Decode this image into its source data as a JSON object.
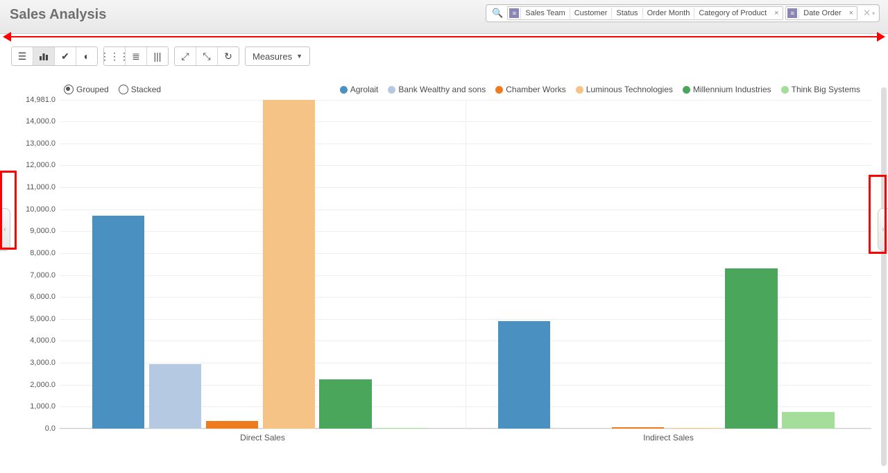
{
  "header": {
    "title": "Sales Analysis",
    "facets": [
      {
        "icon": "≡",
        "segments": [
          "Sales Team",
          "Customer",
          "Status",
          "Order Month",
          "Category of Product"
        ],
        "closable": true
      },
      {
        "icon": "≡",
        "segments": [
          "Date Order"
        ],
        "closable": true
      }
    ]
  },
  "toolbar": {
    "view_buttons": [
      {
        "name": "view-list-button",
        "glyph": "☰",
        "active": false
      },
      {
        "name": "view-chart-button",
        "glyph": "⫿",
        "active": true,
        "is_chart_icon": true
      },
      {
        "name": "view-check-button",
        "glyph": "✔",
        "active": false
      },
      {
        "name": "view-contrast-button",
        "glyph": "◐",
        "active": false
      }
    ],
    "layout_buttons": [
      {
        "name": "layout-grid-button",
        "glyph": "⋮⋮⋮",
        "active": false
      },
      {
        "name": "layout-lines-button",
        "glyph": "≣",
        "active": false
      },
      {
        "name": "layout-columns-button",
        "glyph": "|||",
        "active": false
      }
    ],
    "zoom_buttons": [
      {
        "name": "expand-diag-button",
        "glyph": "⤢",
        "active": false
      },
      {
        "name": "expand-full-button",
        "glyph": "⤡",
        "active": false
      },
      {
        "name": "refresh-button",
        "glyph": "↻",
        "active": false
      }
    ],
    "measures_label": "Measures"
  },
  "chart_controls": {
    "grouped_label": "Grouped",
    "stacked_label": "Stacked",
    "mode": "grouped"
  },
  "legend_colors": {
    "Agrolait": "#4a90c0",
    "Bank Wealthy and sons": "#b6c9e2",
    "Chamber Works": "#ef7b1f",
    "Luminous Technologies": "#f6c387",
    "Millennium Industries": "#4aa65b",
    "Think Big Systems": "#a5dd9a"
  },
  "chart_data": {
    "type": "bar",
    "title": "",
    "xlabel": "",
    "ylabel": "",
    "ylim": [
      0,
      14981
    ],
    "y_ticks": [
      0,
      1000,
      2000,
      3000,
      4000,
      5000,
      6000,
      7000,
      8000,
      9000,
      10000,
      11000,
      12000,
      13000,
      14000,
      14981
    ],
    "y_tick_labels": [
      "0.0",
      "1,000.0",
      "2,000.0",
      "3,000.0",
      "4,000.0",
      "5,000.0",
      "6,000.0",
      "7,000.0",
      "8,000.0",
      "9,000.0",
      "10,000.0",
      "11,000.0",
      "12,000.0",
      "13,000.0",
      "14,000.0",
      "14,981.0"
    ],
    "categories": [
      "Direct Sales",
      "Indirect Sales"
    ],
    "series": [
      {
        "name": "Agrolait",
        "values": [
          9700,
          4900
        ]
      },
      {
        "name": "Bank Wealthy and sons",
        "values": [
          2950,
          0
        ]
      },
      {
        "name": "Chamber Works",
        "values": [
          350,
          60
        ]
      },
      {
        "name": "Luminous Technologies",
        "values": [
          14981,
          40
        ]
      },
      {
        "name": "Millennium Industries",
        "values": [
          2250,
          7300
        ]
      },
      {
        "name": "Think Big Systems",
        "values": [
          30,
          750
        ]
      }
    ]
  }
}
